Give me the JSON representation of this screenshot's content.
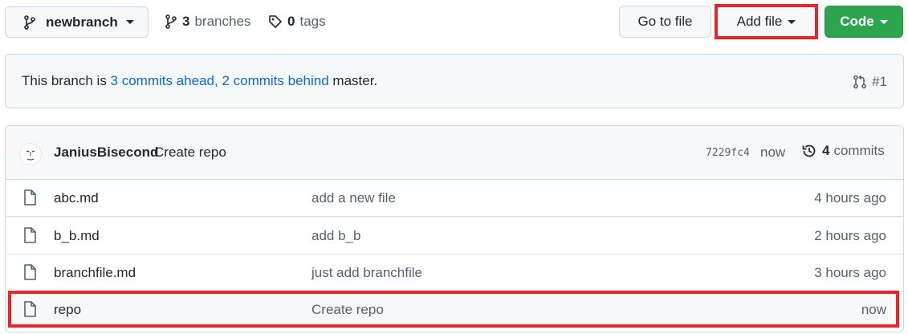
{
  "repo_nav": {
    "branch_name": "newbranch",
    "branches_count": "3",
    "branches_label": "branches",
    "tags_count": "0",
    "tags_label": "tags",
    "go_to_file_label": "Go to file",
    "add_file_label": "Add file",
    "code_label": "Code"
  },
  "branch_info": {
    "prefix": "This branch is ",
    "ahead_link": "3 commits ahead",
    "separator": ", ",
    "behind_link": "2 commits behind",
    "suffix": " master.",
    "pr_ref": "#1"
  },
  "latest_commit": {
    "author": "JaniusBisecond",
    "message": "Create repo",
    "sha": "7229fc4",
    "time": "now",
    "commits_count": "4",
    "commits_label": "commits"
  },
  "files": [
    {
      "name": "abc.md",
      "commit_message": "add a new file",
      "age": "4 hours ago"
    },
    {
      "name": "b_b.md",
      "commit_message": "add b_b",
      "age": "2 hours ago"
    },
    {
      "name": "branchfile.md",
      "commit_message": "just add branchfile",
      "age": "3 hours ago"
    },
    {
      "name": "repo",
      "commit_message": "Create repo",
      "age": "now"
    }
  ],
  "colors": {
    "link": "#0969da",
    "code_button": "#2da44e",
    "highlight": "#e5262b"
  },
  "icons": [
    "git-branch-icon",
    "tag-icon",
    "pull-request-icon",
    "history-icon",
    "file-icon"
  ]
}
